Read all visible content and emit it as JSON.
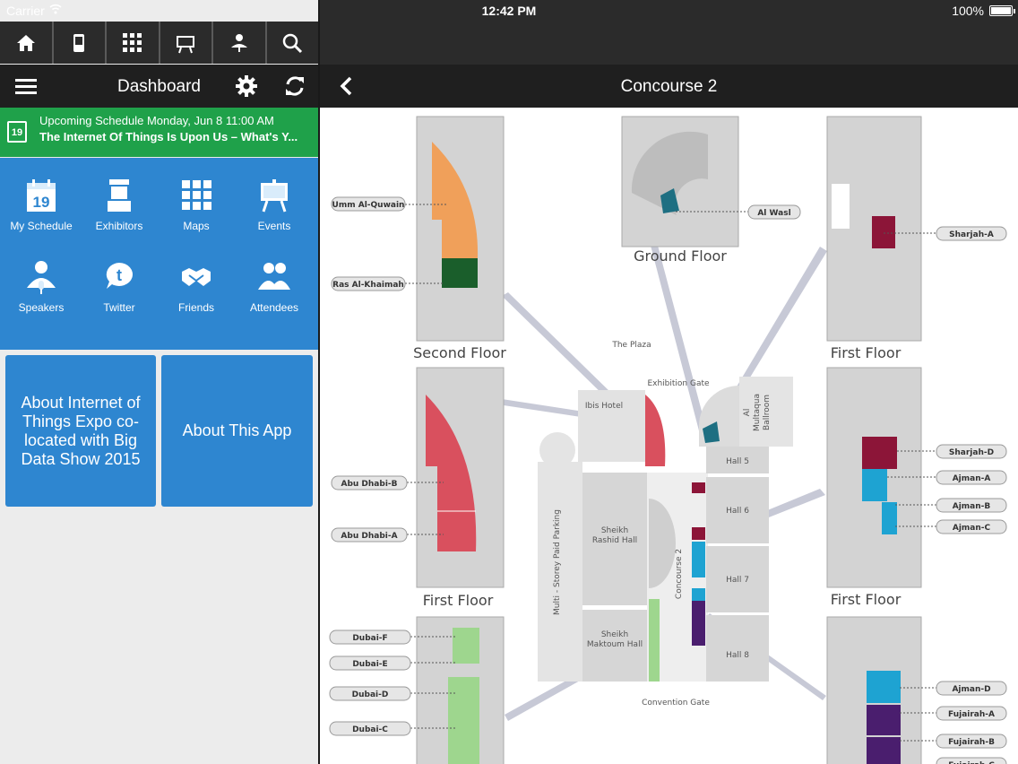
{
  "status_bar": {
    "carrier": "Carrier",
    "time": "12:42 PM",
    "battery": "100%"
  },
  "toolbar": {
    "icons": [
      "home-icon",
      "phone-icon",
      "qr-icon",
      "presentation-icon",
      "speaker-icon",
      "search-icon"
    ]
  },
  "left_header": {
    "title": "Dashboard"
  },
  "upcoming": {
    "calendar_day": "19",
    "line1": "Upcoming Schedule Monday, Jun 8 11:00 AM",
    "line2": "The Internet Of Things Is Upon Us – What's Y..."
  },
  "tiles": [
    {
      "label": "My Schedule",
      "icon": "calendar-icon"
    },
    {
      "label": "Exhibitors",
      "icon": "booth-icon"
    },
    {
      "label": "Maps",
      "icon": "grid-map-icon"
    },
    {
      "label": "Events",
      "icon": "easel-icon"
    },
    {
      "label": "Speakers",
      "icon": "speaker-icon"
    },
    {
      "label": "Twitter",
      "icon": "twitter-icon"
    },
    {
      "label": "Friends",
      "icon": "handshake-icon"
    },
    {
      "label": "Attendees",
      "icon": "people-icon"
    }
  ],
  "cards": {
    "about_expo": "About Internet of Things Expo co-located with Big Data Show 2015",
    "about_app": "About This App"
  },
  "right_header": {
    "title": "Concourse 2"
  },
  "map": {
    "floor_labels": {
      "second": "Second Floor",
      "ground": "Ground Floor",
      "first_tr": "First Floor",
      "first_left": "First Floor",
      "first_right": "First Floor"
    },
    "hall_labels": {
      "umm": "Umm Al-Quwain",
      "ras": "Ras Al-Khaimah",
      "alwasl": "Al Wasl",
      "sharjah_a": "Sharjah-A",
      "abu_b": "Abu Dhabi-B",
      "abu_a": "Abu Dhabi-A",
      "sharjah_d": "Sharjah-D",
      "ajman_a": "Ajman-A",
      "ajman_b": "Ajman-B",
      "ajman_c": "Ajman-C",
      "dubai_f": "Dubai-F",
      "dubai_e": "Dubai-E",
      "dubai_d": "Dubai-D",
      "dubai_c": "Dubai-C",
      "ajman_d": "Ajman-D",
      "fujairah_a": "Fujairah-A",
      "fujairah_b": "Fujairah-B",
      "fujairah_c": "Fujairah-C"
    },
    "site_labels": {
      "plaza": "The Plaza",
      "exhibition_gate": "Exhibition Gate",
      "ibis": "Ibis Hotel",
      "mulltaqua_1": "Al",
      "mulltaqua_2": "Multaqua",
      "mulltaqua_3": "Ballroom",
      "hall5": "Hall 5",
      "hall6": "Hall 6",
      "hall7": "Hall 7",
      "hall8": "Hall 8",
      "rashid_1": "Sheikh",
      "rashid_2": "Rashid Hall",
      "maktoum_1": "Sheikh",
      "maktoum_2": "Maktoum Hall",
      "concourse": "Concourse 2",
      "parking": "Multi - Storey Paid Parking",
      "convention_gate": "Convention Gate"
    }
  }
}
